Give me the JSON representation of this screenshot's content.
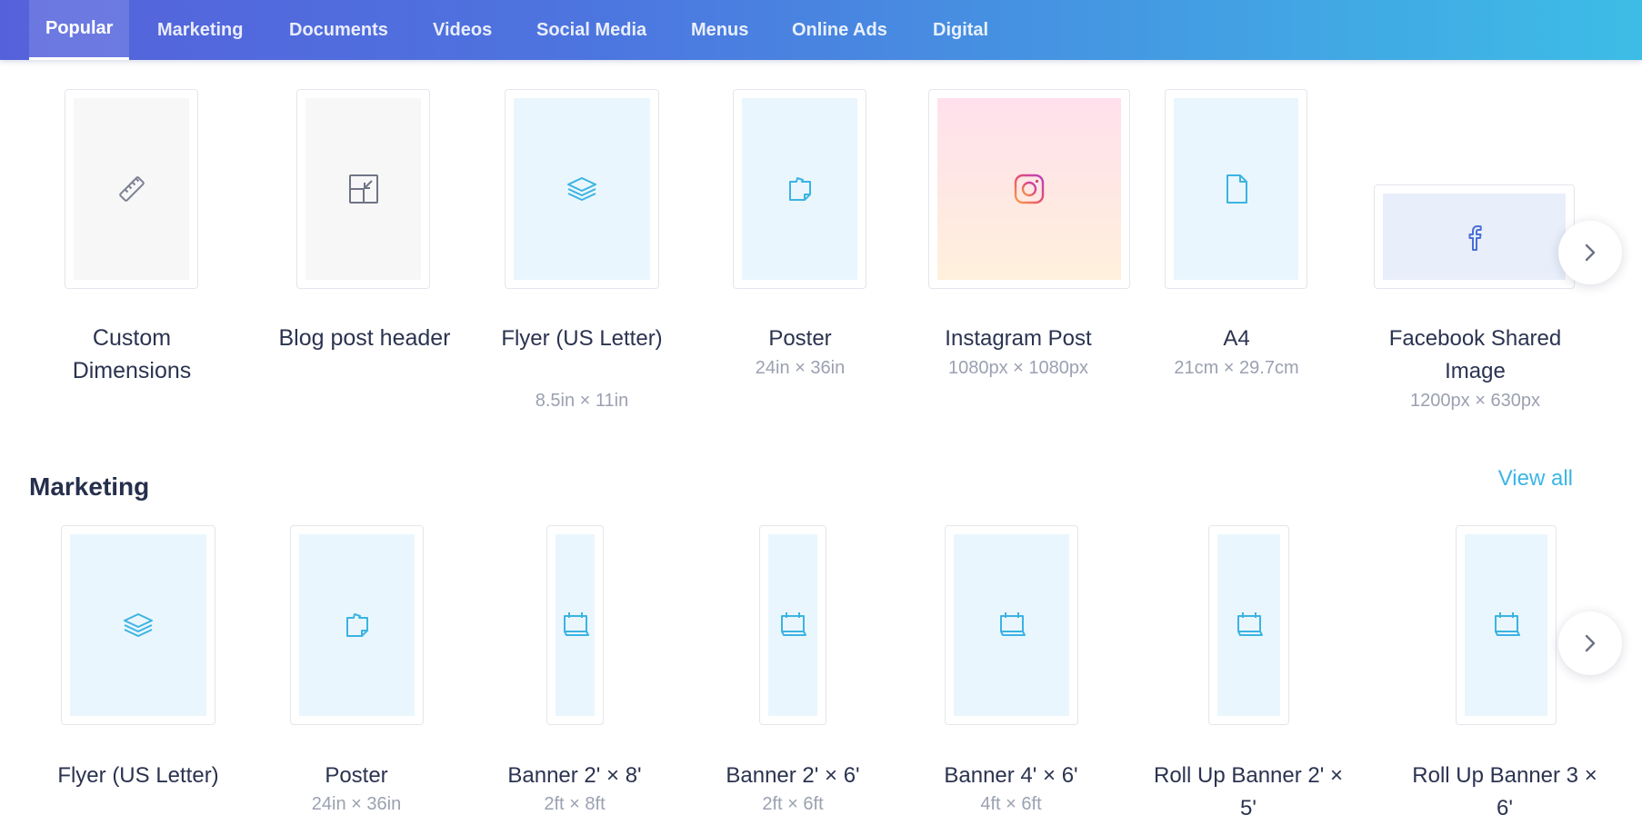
{
  "nav": {
    "tabs": [
      {
        "label": "Popular",
        "active": true
      },
      {
        "label": "Marketing"
      },
      {
        "label": "Documents"
      },
      {
        "label": "Videos"
      },
      {
        "label": "Social Media"
      },
      {
        "label": "Menus"
      },
      {
        "label": "Online Ads"
      },
      {
        "label": "Digital"
      }
    ]
  },
  "popular": {
    "items": [
      {
        "title": "Custom Dimensions",
        "size": "",
        "icon": "ruler-icon"
      },
      {
        "title": "Blog post header",
        "size": "",
        "icon": "resize-icon"
      },
      {
        "title": "Flyer (US Letter)",
        "size": "8.5in × 11in",
        "icon": "layers-icon"
      },
      {
        "title": "Poster",
        "size": "24in × 36in",
        "icon": "poster-icon"
      },
      {
        "title": "Instagram Post",
        "size": "1080px × 1080px",
        "icon": "instagram-icon"
      },
      {
        "title": "A4",
        "size": "21cm × 29.7cm",
        "icon": "document-icon"
      },
      {
        "title": "Facebook Shared Image",
        "size": "1200px × 630px",
        "icon": "facebook-icon"
      }
    ]
  },
  "marketing": {
    "title": "Marketing",
    "view_all": "View all",
    "items": [
      {
        "title": "Flyer (US Letter)",
        "size": "",
        "icon": "layers-icon"
      },
      {
        "title": "Poster",
        "size": "24in × 36in",
        "icon": "poster-icon"
      },
      {
        "title": "Banner 2' × 8'",
        "size": "2ft × 8ft",
        "icon": "banner-icon"
      },
      {
        "title": "Banner 2' × 6'",
        "size": "2ft × 6ft",
        "icon": "banner-icon"
      },
      {
        "title": "Banner 4' × 6'",
        "size": "4ft × 6ft",
        "icon": "banner-icon"
      },
      {
        "title": "Roll Up Banner 2' × 5'",
        "size": "",
        "icon": "banner-icon"
      },
      {
        "title": "Roll Up Banner 3 × 6'",
        "size": "",
        "icon": "banner-icon"
      }
    ]
  },
  "colors": {
    "accent": "#3cb5e5",
    "nav_start": "#5561db",
    "nav_end": "#3dbde6",
    "icon_blue": "#3bb4e2"
  }
}
